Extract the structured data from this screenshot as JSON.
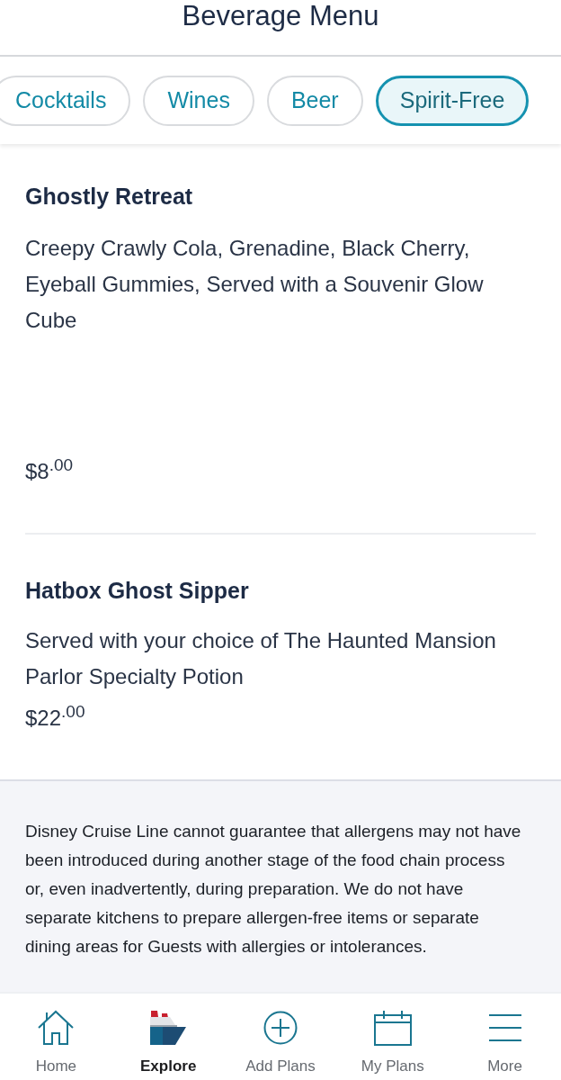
{
  "header": {
    "title": "Beverage Menu"
  },
  "tabs": [
    {
      "label": "Cocktails",
      "selected": false
    },
    {
      "label": "Wines",
      "selected": false
    },
    {
      "label": "Beer",
      "selected": false
    },
    {
      "label": "Spirit-Free",
      "selected": true
    }
  ],
  "items": [
    {
      "name": "Ghostly Retreat",
      "description": "Creepy Crawly Cola, Grenadine, Black Cherry, Eyeball Gummies, Served with a Souvenir Glow Cube",
      "price": "$8$^{.00}$"
    },
    {
      "name": "Hatbox Ghost Sipper",
      "description": "Served with your choice of The Haunted Mansion Parlor Specialty Potion",
      "price": "$22$^{.00}$"
    }
  ],
  "disclaimer": "Disney Cruise Line cannot guarantee that allergens may not have been introduced during another stage of the food chain process or, even inadvertently, during preparation. We do not have separate kitchens to prepare allergen-free items or separate dining areas for Guests with allergies or intolerances.",
  "bottom_nav": [
    {
      "label": "Home",
      "selected": false
    },
    {
      "label": "Explore",
      "selected": true
    },
    {
      "label": "Add Plans",
      "selected": false
    },
    {
      "label": "My Plans",
      "selected": false
    },
    {
      "label": "More",
      "selected": false
    }
  ]
}
